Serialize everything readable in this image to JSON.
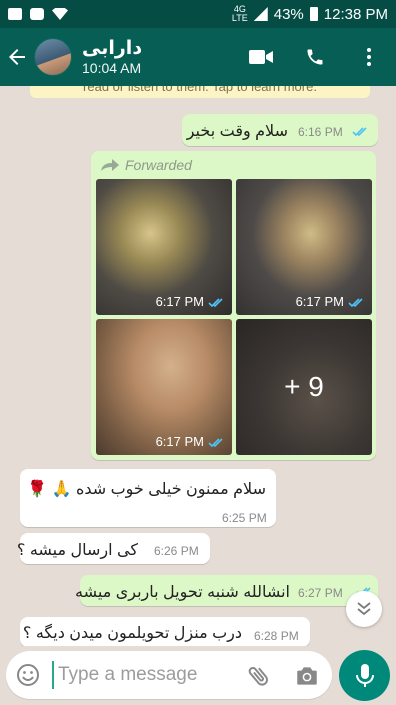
{
  "status_bar": {
    "network": "4G",
    "network_sub": "LTE",
    "battery": "43%",
    "time": "12:38 PM"
  },
  "header": {
    "contact_name": "دارابی",
    "contact_status": "10:04 AM"
  },
  "chat": {
    "system_note": "read or listen to them. Tap to learn more.",
    "messages": [
      {
        "dir": "out",
        "text": "سلام وقت بخیر",
        "time": "6:16 PM"
      },
      {
        "dir": "out",
        "forwarded_label": "Forwarded",
        "photos": [
          {
            "time": "6:17 PM"
          },
          {
            "time": "6:17 PM"
          },
          {
            "time": "6:17 PM"
          },
          {
            "more": "+ 9"
          }
        ]
      },
      {
        "dir": "in",
        "text": "سلام ممنون خیلی خوب شده 🙏 🌹",
        "time": "6:25 PM"
      },
      {
        "dir": "in",
        "text": "کی ارسال میشه ؟",
        "time": "6:26 PM"
      },
      {
        "dir": "out",
        "text": "انشالله شنبه تحویل باربری میشه",
        "time": "6:27 PM"
      },
      {
        "dir": "in",
        "text": "درب منزل تحویلمون میدن دیگه ؟",
        "time": "6:28 PM"
      }
    ]
  },
  "composer": {
    "placeholder": "Type a message"
  },
  "colors": {
    "header": "#075e54",
    "status_bar": "#054d44",
    "outgoing_bubble": "#dcf8c6",
    "incoming_bubble": "#ffffff",
    "read_ticks": "#4fc3f7",
    "mic_button": "#00897b"
  },
  "icons": [
    "back-arrow-icon",
    "video-call-icon",
    "phone-icon",
    "more-options-icon",
    "forward-icon",
    "double-check-icon",
    "scroll-down-icon",
    "emoji-icon",
    "attach-icon",
    "camera-icon",
    "mic-icon"
  ]
}
